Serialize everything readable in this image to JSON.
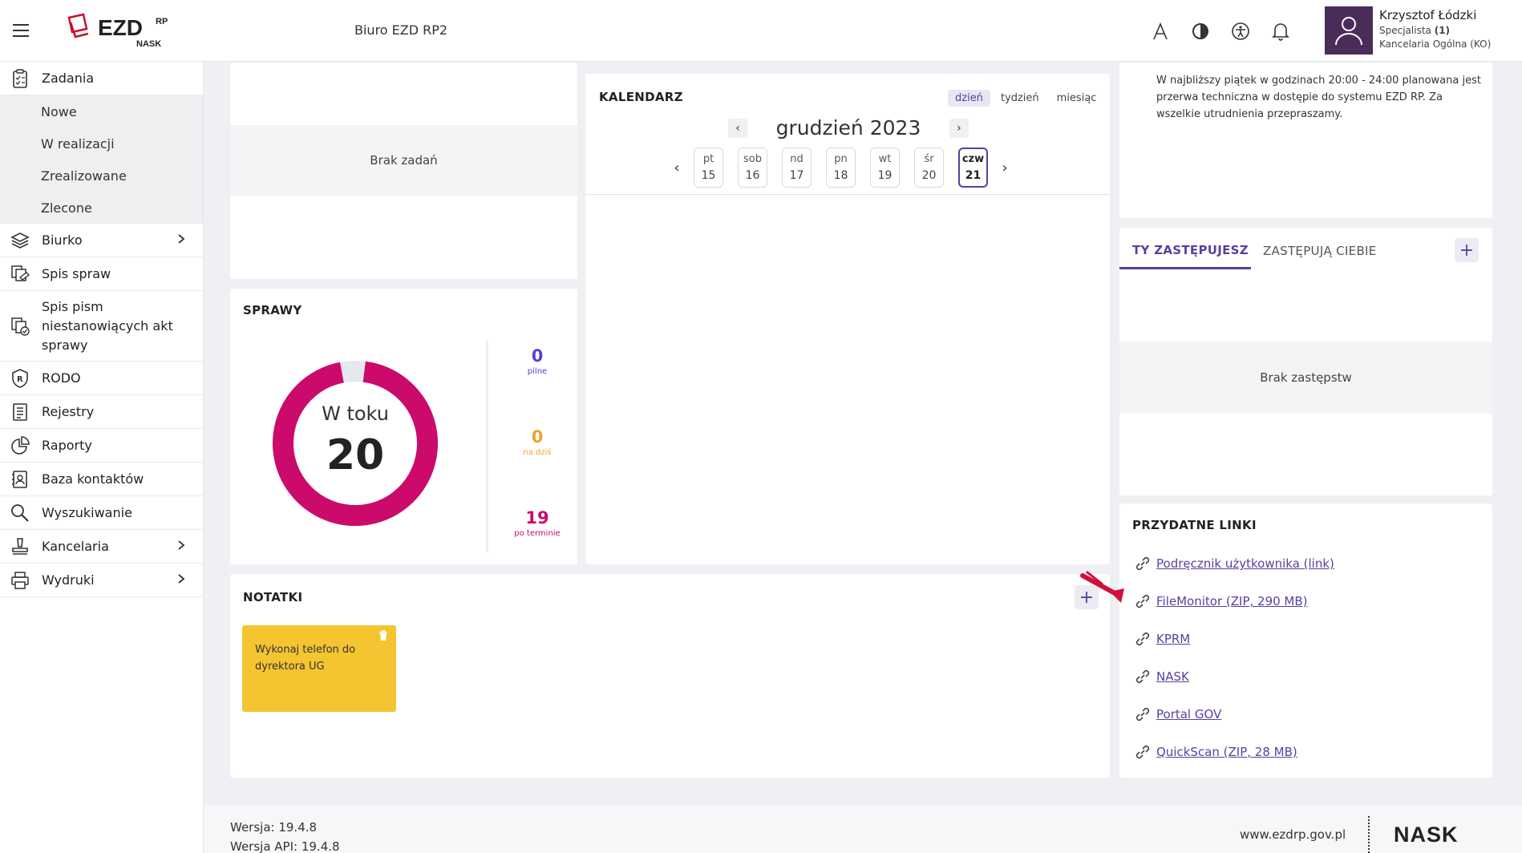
{
  "header": {
    "office_title": "Biuro EZD RP2",
    "logo_text": "EZD",
    "logo_sup": "RP",
    "logo_sub": "NASK",
    "user": {
      "name": "Krzysztof Łódzki",
      "role_prefix": "Specjalista ",
      "role_count": "(1)",
      "department": "Kancelaria Ogólna (KO)"
    }
  },
  "sidebar": {
    "items": [
      {
        "label": "Zadania",
        "icon": "clipboard-icon"
      },
      {
        "label": "Biurko",
        "icon": "layers-icon"
      },
      {
        "label": "Spis spraw",
        "icon": "files-icon"
      },
      {
        "label": "Spis pism niestanowiących akt sprawy",
        "icon": "docs-check-icon"
      },
      {
        "label": "RODO",
        "icon": "shield-r-icon"
      },
      {
        "label": "Rejestry",
        "icon": "register-icon"
      },
      {
        "label": "Raporty",
        "icon": "pie-chart-icon"
      },
      {
        "label": "Baza kontaktów",
        "icon": "contacts-icon"
      },
      {
        "label": "Wyszukiwanie",
        "icon": "search-icon"
      },
      {
        "label": "Kancelaria",
        "icon": "stamp-icon"
      },
      {
        "label": "Wydruki",
        "icon": "printer-icon"
      }
    ],
    "sub_items": [
      "Nowe",
      "W realizacji",
      "Zrealizowane",
      "Zlecone"
    ]
  },
  "tasks": {
    "empty_text": "Brak zadań"
  },
  "calendar": {
    "title": "KALENDARZ",
    "views": [
      "dzień",
      "tydzień",
      "miesiąc"
    ],
    "month": "grudzień 2023",
    "days": [
      {
        "name": "pt",
        "num": "15"
      },
      {
        "name": "sob",
        "num": "16"
      },
      {
        "name": "nd",
        "num": "17"
      },
      {
        "name": "pn",
        "num": "18"
      },
      {
        "name": "wt",
        "num": "19"
      },
      {
        "name": "śr",
        "num": "20"
      },
      {
        "name": "czw",
        "num": "21"
      }
    ]
  },
  "cases": {
    "title": "SPRAWY",
    "donut_label": "W toku",
    "donut_value": "20",
    "donut_fraction_filled": 0.95,
    "colors": {
      "accent": "#cc0a6c",
      "empty": "#e5e8ee"
    },
    "stats": [
      {
        "value": "0",
        "label": "pilne",
        "color": "#5a3fd0"
      },
      {
        "value": "0",
        "label": "na dziś",
        "color": "#f0a22c"
      },
      {
        "value": "19",
        "label": "po terminie",
        "color": "#cc0a6c"
      }
    ]
  },
  "notes": {
    "title": "NOTATKI",
    "items": [
      {
        "text": "Wykonaj telefon do dyrektora UG"
      }
    ]
  },
  "announcement": {
    "text": "W najbliższy piątek w godzinach 20:00 - 24:00 planowana jest przerwa techniczna w dostępie do systemu EZD RP. Za wszelkie utrudnienia przepraszamy."
  },
  "substitutions": {
    "tabs": [
      "TY ZASTĘPUJESZ",
      "ZASTĘPUJĄ CIEBIE"
    ],
    "empty_text": "Brak zastępstw"
  },
  "links": {
    "title": "PRZYDATNE LINKI",
    "items": [
      "Podręcznik użytkownika (link)",
      "FileMonitor (ZIP, 290 MB)",
      "KPRM",
      "NASK",
      "Portal GOV",
      "QuickScan (ZIP, 28 MB)"
    ]
  },
  "footer": {
    "version": "Wersja: 19.4.8",
    "api_version": "Wersja API: 19.4.8",
    "url": "www.ezdrp.gov.pl",
    "brand": "NASK"
  }
}
